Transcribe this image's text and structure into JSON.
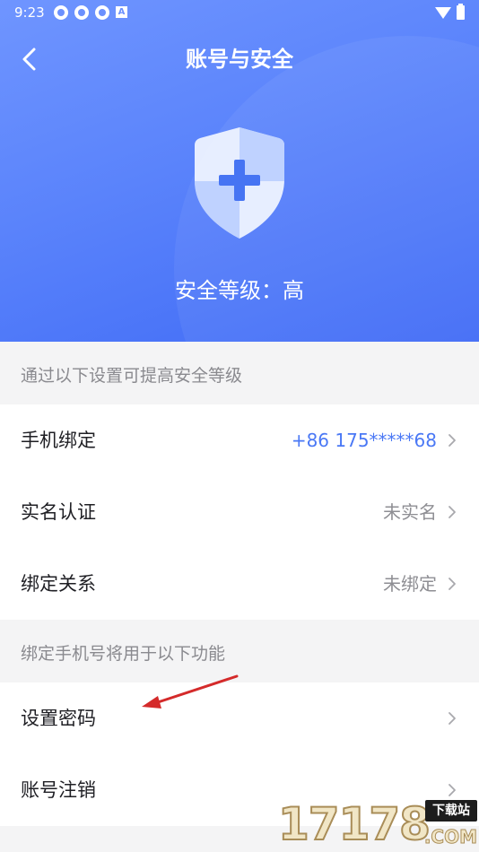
{
  "status_bar": {
    "time": "9:23",
    "notification_icons": [
      "app-icon",
      "app-icon",
      "app-icon",
      "a-icon"
    ],
    "a_glyph": "A"
  },
  "nav": {
    "back_icon": "chevron-left-icon",
    "title": "账号与安全"
  },
  "hero": {
    "shield_icon": "shield-plus-icon",
    "security_level": "安全等级：高",
    "gradient_colors": [
      "#6f95ff",
      "#3f6af6"
    ]
  },
  "section_security": {
    "header": "通过以下设置可提高安全等级",
    "items": [
      {
        "label": "手机绑定",
        "value": "+86  175*****68",
        "accent": true
      },
      {
        "label": "实名认证",
        "value": "未实名",
        "accent": false
      },
      {
        "label": "绑定关系",
        "value": "未绑定",
        "accent": false
      }
    ]
  },
  "section_functions": {
    "header": "绑定手机号将用于以下功能",
    "items": [
      {
        "label": "设置密码",
        "value": ""
      },
      {
        "label": "账号注销",
        "value": ""
      }
    ]
  },
  "overlay": {
    "annotation_arrow_color": "#d42a2a"
  },
  "watermark": {
    "digits": "17178",
    "tag": "下载站",
    "suffix": ".COM"
  },
  "colors": {
    "accent": "#4a78f5",
    "background": "#f4f4f5"
  }
}
